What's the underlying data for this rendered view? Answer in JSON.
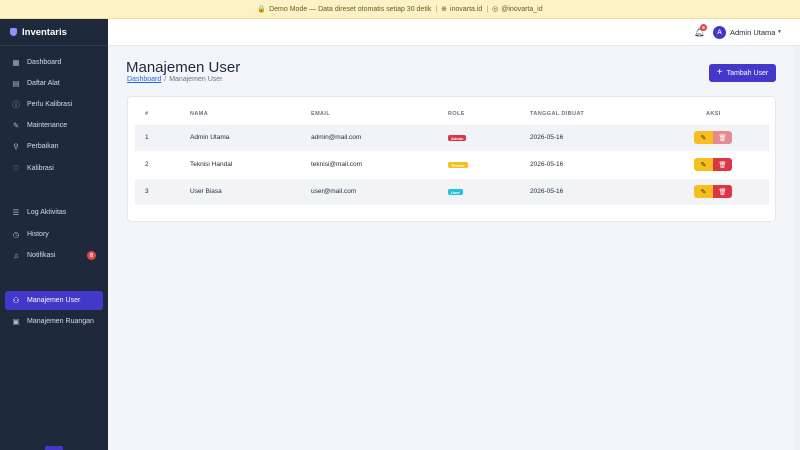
{
  "banner": {
    "lock_icon": "🔒",
    "text": "Demo Mode — Data direset otomatis setiap 30 detik",
    "globe_icon": "⊕",
    "site": "inovarta.id",
    "social_icon": "◎",
    "handle": "@inovarta_id"
  },
  "brand": {
    "name": "Inventaris"
  },
  "nav": {
    "items": [
      {
        "label": "Dashboard",
        "icon": "▦"
      },
      {
        "label": "Daftar Alat",
        "icon": "▤"
      },
      {
        "label": "Perlu Kalibrasi",
        "icon": "ⓘ"
      },
      {
        "label": "Maintenance",
        "icon": "✎"
      },
      {
        "label": "Perbaikan",
        "icon": "⚲"
      },
      {
        "label": "Kalibrasi",
        "icon": "♡"
      },
      {
        "label": "Log Aktivitas",
        "icon": "☰"
      },
      {
        "label": "History",
        "icon": "◷"
      },
      {
        "label": "Notifikasi",
        "icon": "♫",
        "badge": "8"
      },
      {
        "label": "Manajemen User",
        "icon": "⚇"
      },
      {
        "label": "Manajemen Ruangan",
        "icon": "▣"
      }
    ]
  },
  "topbar": {
    "notif_count": "8",
    "avatar_initial": "A",
    "user_name": "Admin Utama"
  },
  "page": {
    "title": "Manajemen User",
    "breadcrumb_home": "Dashboard",
    "breadcrumb_sep": "/",
    "breadcrumb_current": "Manajemen User",
    "add_button": "Tambah User"
  },
  "table": {
    "headers": [
      "#",
      "NAMA",
      "EMAIL",
      "ROLE",
      "TANGGAL DIBUAT",
      "AKSI"
    ],
    "rows": [
      {
        "no": "1",
        "name": "Admin Utama",
        "email": "admin@mail.com",
        "role": "Admin",
        "date": "2026-05-16"
      },
      {
        "no": "2",
        "name": "Teknisi Handal",
        "email": "teknisi@mail.com",
        "role": "Teknisi",
        "date": "2026-05-16"
      },
      {
        "no": "3",
        "name": "User Biasa",
        "email": "user@mail.com",
        "role": "User",
        "date": "2026-05-16"
      }
    ]
  },
  "colors": {
    "primary": "#4338ca",
    "sidebar": "#1e2a3b",
    "admin": "#dc3545",
    "teknisi": "#f6bf1e",
    "user": "#1fc2d8"
  }
}
